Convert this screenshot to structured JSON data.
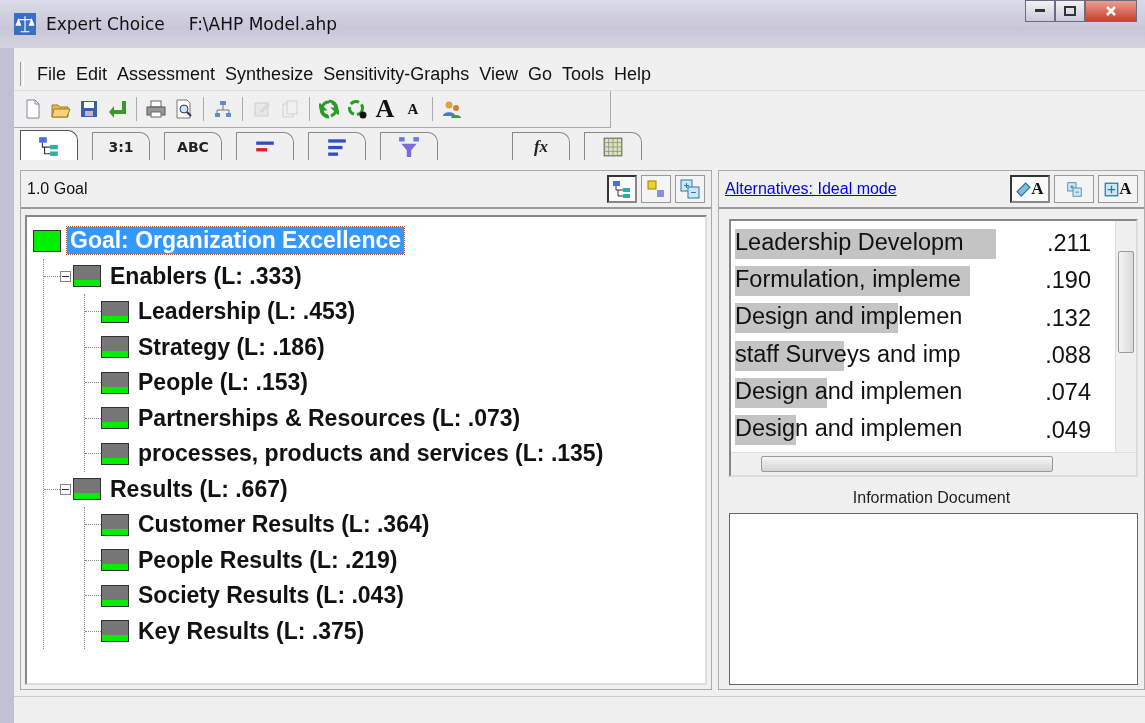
{
  "window": {
    "app": "Expert Choice",
    "file": "F:\\AHP Model.ahp"
  },
  "menu": [
    "File",
    "Edit",
    "Assessment",
    "Synthesize",
    "Sensitivity-Graphs",
    "View",
    "Go",
    "Tools",
    "Help"
  ],
  "toolbar": [
    [
      {
        "kind": "new",
        "disabled": false
      },
      {
        "kind": "open",
        "disabled": false
      },
      {
        "kind": "save",
        "disabled": false
      },
      {
        "kind": "return",
        "disabled": false
      }
    ],
    [
      {
        "kind": "print",
        "disabled": false
      },
      {
        "kind": "preview",
        "disabled": false
      }
    ],
    [
      {
        "kind": "hierarchy",
        "disabled": false
      }
    ],
    [
      {
        "kind": "edit",
        "disabled": true
      },
      {
        "kind": "pages",
        "disabled": true
      }
    ],
    [
      {
        "kind": "recycle",
        "disabled": false
      },
      {
        "kind": "recycle-dot",
        "disabled": false
      },
      {
        "kind": "font-up",
        "label": "A",
        "disabled": false
      },
      {
        "kind": "font-down",
        "label": "A",
        "disabled": false
      }
    ],
    [
      {
        "kind": "users",
        "disabled": false
      }
    ]
  ],
  "tabs": [
    {
      "kind": "tree",
      "selected": true
    },
    {
      "kind": "text",
      "label": "3:1",
      "selected": false
    },
    {
      "kind": "text",
      "label": "ABC",
      "selected": false
    },
    {
      "kind": "bars-red",
      "selected": false
    },
    {
      "kind": "bars-blue",
      "selected": false
    },
    {
      "kind": "funnel",
      "selected": false
    },
    {
      "kind": "formula",
      "label": "fx",
      "selected": false
    },
    {
      "kind": "grid",
      "selected": false
    }
  ],
  "model_panel": {
    "title": "1.0 Goal",
    "view_buttons": [
      {
        "kind": "tree",
        "selected": true
      },
      {
        "kind": "nodes",
        "selected": false
      },
      {
        "kind": "plus-minus",
        "selected": false
      }
    ],
    "tree": {
      "kind": "goal",
      "label": "Goal: Organization Excellence",
      "selected": true,
      "children": [
        {
          "kind": "criterion",
          "label": "Enablers (L: .333)",
          "selected": false,
          "expanded": true,
          "children": [
            {
              "kind": "criterion",
              "label": "Leadership (L: .453)",
              "selected": false
            },
            {
              "kind": "criterion",
              "label": "Strategy (L: .186)",
              "selected": false
            },
            {
              "kind": "criterion",
              "label": "People (L: .153)",
              "selected": false
            },
            {
              "kind": "criterion",
              "label": "Partnerships & Resources (L: .073)",
              "selected": false
            },
            {
              "kind": "criterion",
              "label": "processes, products and services (L: .135)",
              "selected": false
            }
          ]
        },
        {
          "kind": "criterion",
          "label": "Results (L: .667)",
          "selected": false,
          "expanded": true,
          "children": [
            {
              "kind": "criterion",
              "label": "Customer Results (L: .364)",
              "selected": false
            },
            {
              "kind": "criterion",
              "label": "People Results (L: .219)",
              "selected": false
            },
            {
              "kind": "criterion",
              "label": "Society Results (L: .043)",
              "selected": false
            },
            {
              "kind": "criterion",
              "label": "Key Results (L: .375)",
              "selected": false
            }
          ]
        }
      ]
    }
  },
  "alternatives_panel": {
    "link": "Alternatives: Ideal mode",
    "buttons": [
      {
        "kind": "font-edit",
        "label": "A",
        "selected": true
      },
      {
        "kind": "plus-minus",
        "selected": false
      },
      {
        "kind": "add-font",
        "label": "A",
        "selected": false
      }
    ],
    "alternatives": [
      {
        "name": "Leadership Developm",
        "value": ".211"
      },
      {
        "name": "Formulation, impleme",
        "value": ".190"
      },
      {
        "name": "Design and implemen",
        "value": ".132"
      },
      {
        "name": "staff Surveys and imp",
        "value": ".088"
      },
      {
        "name": "Design and implemen",
        "value": ".074"
      },
      {
        "name": "Design and implemen",
        "value": ".049"
      }
    ],
    "info_label": "Information Document"
  }
}
